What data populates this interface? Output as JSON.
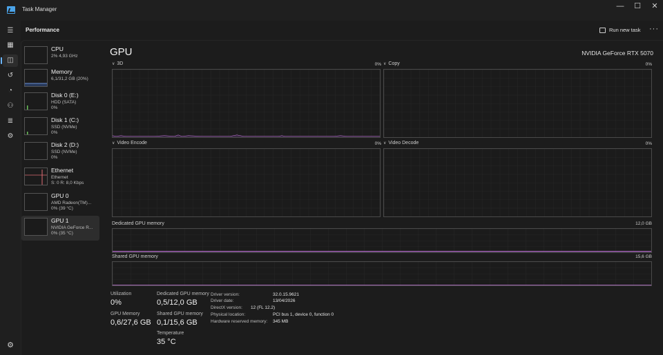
{
  "window": {
    "title": "Task Manager",
    "minimize": "—",
    "maximize": "☐",
    "close": "✕"
  },
  "header": {
    "page_title": "Performance",
    "run_new_task": "Run new task",
    "more": "···"
  },
  "colors": {
    "accent": "#6cb6ff",
    "gpu_line": "#c678dd",
    "cpu_line": "#4aa3e8",
    "memory_line": "#6b8fd6",
    "disk_line": "#6ac259",
    "net_line": "#e06c75"
  },
  "sidebar": [
    {
      "name": "CPU",
      "sub1": "2%  4,93 GHz",
      "sub2": "",
      "selected": false,
      "icon": "cpu-thumb"
    },
    {
      "name": "Memory",
      "sub1": "6,1/31,2 GB (20%)",
      "sub2": "",
      "selected": false,
      "icon": "memory-thumb"
    },
    {
      "name": "Disk 0 (E:)",
      "sub1": "HDD (SATA)",
      "sub2": "0%",
      "selected": false,
      "icon": "disk-thumb"
    },
    {
      "name": "Disk 1 (C:)",
      "sub1": "SSD (NVMe)",
      "sub2": "0%",
      "selected": false,
      "icon": "disk-thumb"
    },
    {
      "name": "Disk 2 (D:)",
      "sub1": "SSD (NVMe)",
      "sub2": "0%",
      "selected": false,
      "icon": "disk-thumb"
    },
    {
      "name": "Ethernet",
      "sub1": "Ethernet",
      "sub2": "S: 0 R: 8,0 Kbps",
      "selected": false,
      "icon": "ethernet-thumb"
    },
    {
      "name": "GPU 0",
      "sub1": "AMD Radeon(TM)...",
      "sub2": "0% (39 °C)",
      "selected": false,
      "icon": "gpu-thumb"
    },
    {
      "name": "GPU 1",
      "sub1": "NVIDIA GeForce R...",
      "sub2": "0% (35 °C)",
      "selected": true,
      "icon": "gpu-thumb"
    }
  ],
  "gpu": {
    "title": "GPU",
    "model": "NVIDIA GeForce RTX 5070",
    "engines": [
      {
        "label": "3D",
        "pct": "0%"
      },
      {
        "label": "Copy",
        "pct": "0%"
      },
      {
        "label": "Video Encode",
        "pct": "0%"
      },
      {
        "label": "Video Decode",
        "pct": "0%"
      }
    ],
    "dedicated_memory": {
      "label": "Dedicated GPU memory",
      "max": "12,0 GB"
    },
    "shared_memory": {
      "label": "Shared GPU memory",
      "max": "15,6 GB"
    }
  },
  "stats": {
    "utilization": {
      "label": "Utilization",
      "value": "0%"
    },
    "dedicated": {
      "label": "Dedicated GPU memory",
      "value": "0,5/12,0 GB"
    },
    "gpu_memory": {
      "label": "GPU Memory",
      "value": "0,6/27,6 GB"
    },
    "shared": {
      "label": "Shared GPU memory",
      "value": "0,1/15,6 GB"
    },
    "temperature": {
      "label": "Temperature",
      "value": "35 °C"
    }
  },
  "info": [
    {
      "label": "Driver version:",
      "value": "32.0.15.9621"
    },
    {
      "label": "Driver date:",
      "value": "13/04/2026"
    },
    {
      "label": "DirectX version:",
      "value": "12 (FL 12.2)"
    },
    {
      "label": "Physical location:",
      "value": "PCI bus 1, device 0, function 0"
    },
    {
      "label": "Hardware reserved memory:",
      "value": "345 MB"
    }
  ]
}
